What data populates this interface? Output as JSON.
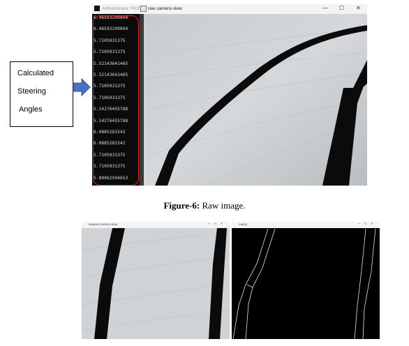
{
  "callout": {
    "line1": "Calculated",
    "line2": "Steering",
    "line3": "Angles"
  },
  "console_window": {
    "title": "Administrator: ROS",
    "values": [
      "6.46593209894",
      "6.46593209894",
      "5.7105931375",
      "5.7105931375",
      "5.52143641465",
      "5.52143641465",
      "5.7105931375",
      "5.7105931375",
      "5.14276455788",
      "5.14276455788",
      "6.0885281542",
      "6.0885281542",
      "5.7105931375",
      "5.7105931375",
      "5.89962504653"
    ]
  },
  "camera_window": {
    "title": "raw camera view",
    "controls": [
      "—",
      "☐",
      "✕"
    ]
  },
  "caption": {
    "label": "Figure-6:",
    "text": " Raw image."
  },
  "warped_window": {
    "title": "warped camera view"
  },
  "canny_window": {
    "title": "canny"
  },
  "colors": {
    "arrow": "#4472c4",
    "highlight": "#e0291d",
    "tape": "#0a0a0a",
    "floor": "#c9cdd0"
  }
}
